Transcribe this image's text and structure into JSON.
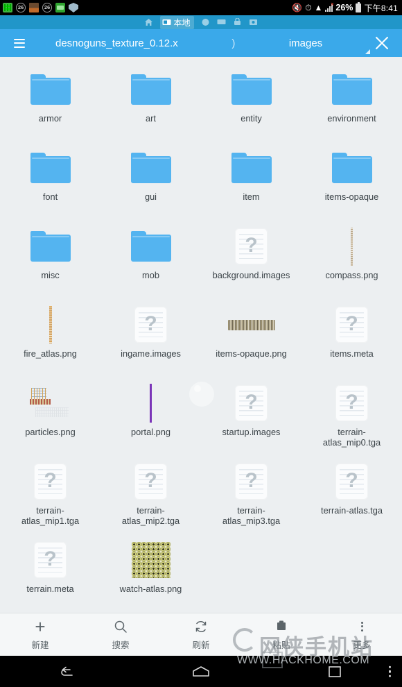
{
  "statusbar": {
    "icons_left": [
      "qr-code-icon",
      "notification-count-26-icon",
      "photo-icon",
      "notification-count-26-2-icon",
      "message-icon",
      "shield-icon"
    ],
    "badge_count": "26",
    "mute_icon": "volume-mute-icon",
    "alarm_icon": "alarm-clock-icon",
    "wifi_icon": "wifi-icon",
    "signal_icon": "cellular-signal-no-service-icon",
    "battery_percent": "26%",
    "battery_icon": "battery-icon",
    "clock": "下午8:41"
  },
  "tabstrip": {
    "home_icon": "home-icon",
    "active_tab": {
      "label": "本地",
      "icon": "device-icon"
    },
    "inactive_icons": [
      "cloud-icon",
      "network-icon",
      "ftp-icon",
      "remote-icon"
    ]
  },
  "titlebar": {
    "menu_icon": "list-menu-icon",
    "breadcrumb_1": "desnoguns_texture_0.12.x",
    "breadcrumb_sep": ")",
    "breadcrumb_2": "images",
    "resize_icon": "resize-corner-icon",
    "close_icon": "close-icon",
    "accent_color": "#3aa9ea"
  },
  "files": [
    {
      "name": "armor",
      "type": "folder",
      "thumb": "folder-icon"
    },
    {
      "name": "art",
      "type": "folder",
      "thumb": "folder-icon"
    },
    {
      "name": "entity",
      "type": "folder",
      "thumb": "folder-icon"
    },
    {
      "name": "environment",
      "type": "folder",
      "thumb": "folder-icon"
    },
    {
      "name": "font",
      "type": "folder",
      "thumb": "folder-icon"
    },
    {
      "name": "gui",
      "type": "folder",
      "thumb": "folder-icon"
    },
    {
      "name": "item",
      "type": "folder",
      "thumb": "folder-icon"
    },
    {
      "name": "items-opaque",
      "type": "folder",
      "thumb": "folder-icon"
    },
    {
      "name": "misc",
      "type": "folder",
      "thumb": "folder-icon"
    },
    {
      "name": "mob",
      "type": "folder",
      "thumb": "folder-icon"
    },
    {
      "name": "background.images",
      "type": "unknown",
      "thumb": "unknown-file-icon"
    },
    {
      "name": "compass.png",
      "type": "image",
      "thumb": "compass-strip-thumbnail"
    },
    {
      "name": "fire_atlas.png",
      "type": "image",
      "thumb": "fire-atlas-strip-thumbnail"
    },
    {
      "name": "ingame.images",
      "type": "unknown",
      "thumb": "unknown-file-icon"
    },
    {
      "name": "items-opaque.png",
      "type": "image",
      "thumb": "items-opaque-atlas-thumbnail"
    },
    {
      "name": "items.meta",
      "type": "unknown",
      "thumb": "unknown-file-icon"
    },
    {
      "name": "particles.png",
      "type": "image",
      "thumb": "particles-atlas-thumbnail"
    },
    {
      "name": "portal.png",
      "type": "image",
      "thumb": "portal-strip-thumbnail"
    },
    {
      "name": "startup.images",
      "type": "unknown",
      "thumb": "unknown-file-icon"
    },
    {
      "name": "terrain-atlas_mip0.tga",
      "type": "unknown",
      "thumb": "unknown-file-icon"
    },
    {
      "name": "terrain-atlas_mip1.tga",
      "type": "unknown",
      "thumb": "unknown-file-icon"
    },
    {
      "name": "terrain-atlas_mip2.tga",
      "type": "unknown",
      "thumb": "unknown-file-icon"
    },
    {
      "name": "terrain-atlas_mip3.tga",
      "type": "unknown",
      "thumb": "unknown-file-icon"
    },
    {
      "name": "terrain-atlas.tga",
      "type": "unknown",
      "thumb": "unknown-file-icon"
    },
    {
      "name": "terrain.meta",
      "type": "unknown",
      "thumb": "unknown-file-icon"
    },
    {
      "name": "watch-atlas.png",
      "type": "image",
      "thumb": "watch-atlas-thumbnail"
    }
  ],
  "loading_indicator": "thumbnail-loading-spinner",
  "bottombar": [
    {
      "label": "新建",
      "icon": "plus-icon"
    },
    {
      "label": "搜索",
      "icon": "search-icon"
    },
    {
      "label": "刷新",
      "icon": "refresh-icon"
    },
    {
      "label": "粘贴",
      "icon": "paste-icon"
    },
    {
      "label": "更多",
      "icon": "overflow-menu-icon"
    }
  ],
  "navbar": {
    "back_icon": "back-arrow-icon",
    "home_icon": "home-pentagon-icon",
    "recents_icon": "recent-apps-icon",
    "menu_icon": "nav-overflow-icon"
  },
  "watermark": {
    "title": "网侠手机站",
    "url": "WWW.HACKHOME.COM"
  }
}
